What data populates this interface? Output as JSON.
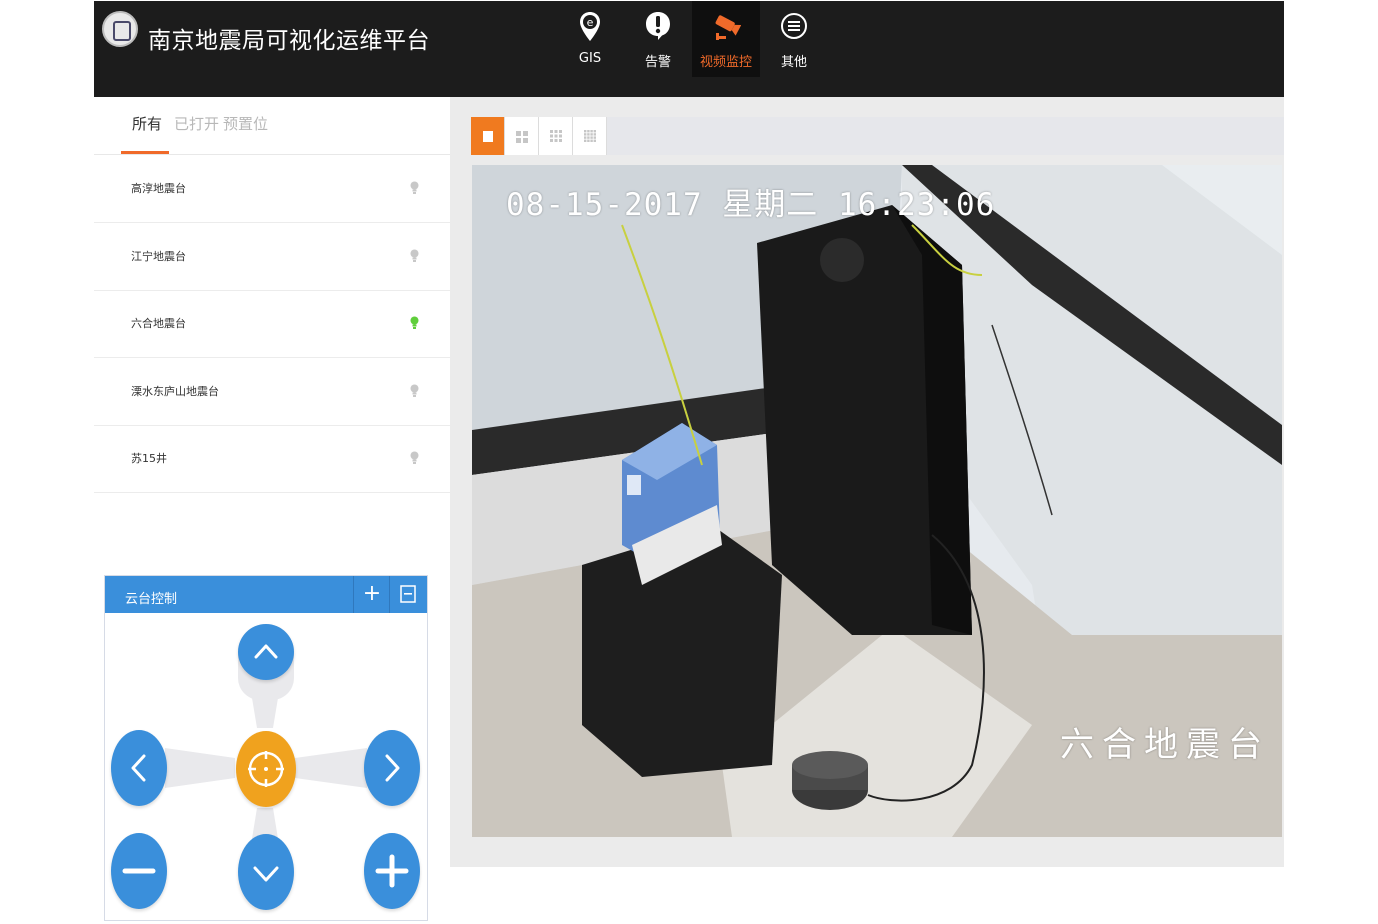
{
  "app": {
    "title": "南京地震局可视化运维平台"
  },
  "nav": [
    {
      "label": "GIS",
      "icon": "map-pin-e-icon"
    },
    {
      "label": "告警",
      "icon": "alert-icon"
    },
    {
      "label": "视频监控",
      "icon": "camera-icon",
      "active": true
    },
    {
      "label": "其他",
      "icon": "menu-icon"
    }
  ],
  "tabs": [
    {
      "label": "所有",
      "active": true
    },
    {
      "label": "已打开"
    },
    {
      "label": "预置位"
    }
  ],
  "stations": [
    {
      "name": "高淳地震台",
      "online": false
    },
    {
      "name": "江宁地震台",
      "online": false
    },
    {
      "name": "六合地震台",
      "online": true
    },
    {
      "name": "溧水东庐山地震台",
      "online": false
    },
    {
      "name": "苏15井",
      "online": false
    }
  ],
  "ptz": {
    "title": "云台控制",
    "add_label": "+",
    "minimize_label": "−"
  },
  "layouts": [
    "1x1",
    "2x2",
    "3x3",
    "4x4"
  ],
  "video": {
    "osd_time": "08-15-2017 星期二 16:23:06",
    "osd_name": "六合地震台"
  },
  "colors": {
    "accent": "#f06a2a",
    "online": "#5fce3b",
    "offline": "#c8c8c8",
    "ptz_blue": "#3a8fdb",
    "ptz_orange": "#f0a21e"
  }
}
